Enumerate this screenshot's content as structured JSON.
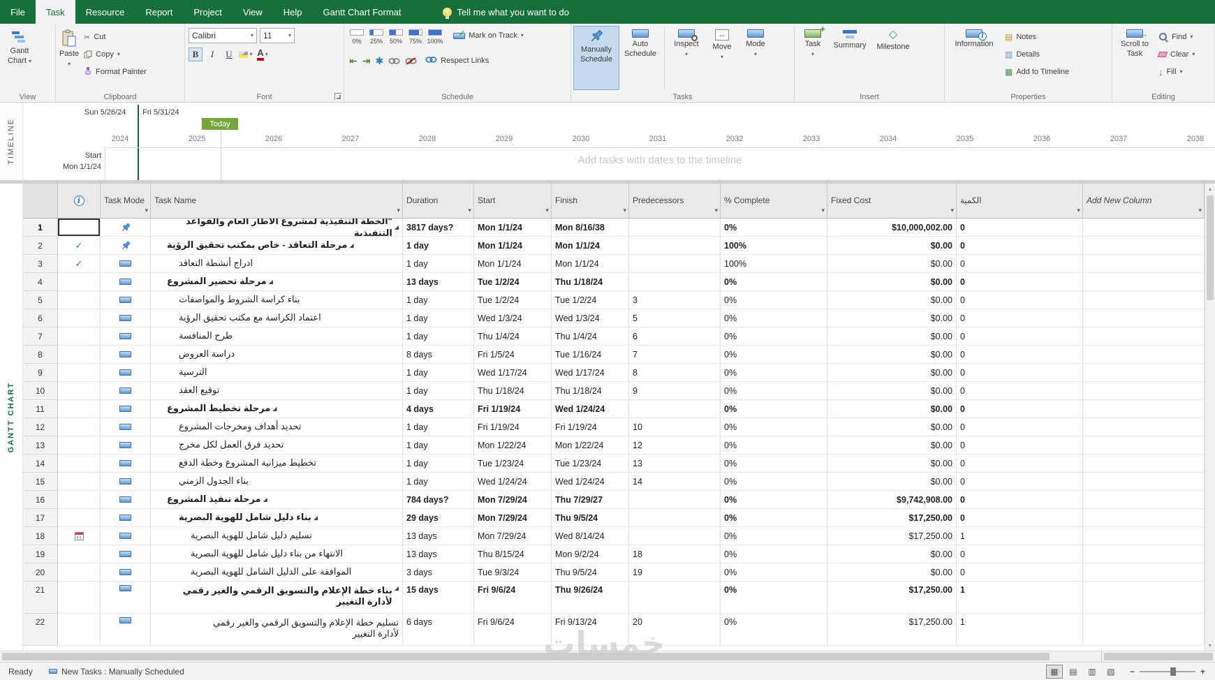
{
  "colors": {
    "brand_green": "#16703C",
    "accent_blue": "#2E75B6",
    "today_green": "#74A63D",
    "selection_blue": "#C5DAEE"
  },
  "menu": {
    "tabs": [
      {
        "label": "File"
      },
      {
        "label": "Task",
        "active": true
      },
      {
        "label": "Resource"
      },
      {
        "label": "Report"
      },
      {
        "label": "Project"
      },
      {
        "label": "View"
      },
      {
        "label": "Help"
      },
      {
        "label": "Gantt Chart Format"
      }
    ],
    "tell_me": "Tell me what you want to do"
  },
  "ribbon": {
    "view": {
      "group_label": "View",
      "gantt_chart": "Gantt Chart"
    },
    "clipboard": {
      "group_label": "Clipboard",
      "paste": "Paste",
      "cut": "Cut",
      "copy": "Copy",
      "format_painter": "Format Painter"
    },
    "font": {
      "group_label": "Font",
      "font_name": "Calibri",
      "font_size": "11",
      "bold": "B",
      "italic": "I",
      "underline": "U",
      "color_letter": "A"
    },
    "schedule": {
      "group_label": "Schedule",
      "percents": [
        "0%",
        "25%",
        "50%",
        "75%",
        "100%"
      ],
      "mark_on_track": "Mark on Track",
      "respect_links": "Respect Links"
    },
    "tasks": {
      "group_label": "Tasks",
      "manually_schedule": "Manually Schedule",
      "auto_schedule": "Auto Schedule",
      "inspect": "Inspect",
      "move": "Move",
      "mode": "Mode"
    },
    "insert": {
      "group_label": "Insert",
      "task": "Task",
      "summary": "Summary",
      "milestone": "Milestone"
    },
    "properties": {
      "group_label": "Properties",
      "information": "Information",
      "notes": "Notes",
      "details": "Details",
      "add_to_timeline": "Add to Timeline"
    },
    "editing": {
      "group_label": "Editing",
      "scroll_to_task": "Scroll to Task",
      "find": "Find",
      "clear": "Clear",
      "fill": "Fill"
    }
  },
  "timeline": {
    "pane_label": "TIMELINE",
    "range_start": "Sun 5/26/24",
    "range_end": "Fri 5/31/24",
    "today": "Today",
    "years": [
      "2024",
      "2025",
      "2026",
      "2027",
      "2028",
      "2029",
      "2030",
      "2031",
      "2032",
      "2033",
      "2034",
      "2035",
      "2036",
      "2037",
      "2038"
    ],
    "start_label": "Start",
    "start_date": "Mon 1/1/24",
    "placeholder": "Add tasks with dates to the timeline"
  },
  "gantt": {
    "pane_label": "GANTT CHART"
  },
  "table": {
    "columns": [
      {
        "id": "num",
        "label": "",
        "filter": false
      },
      {
        "id": "info",
        "label": "i",
        "filter": false
      },
      {
        "id": "mode",
        "label": "Task Mode",
        "filter": true
      },
      {
        "id": "name",
        "label": "Task Name",
        "filter": true
      },
      {
        "id": "dur",
        "label": "Duration",
        "filter": true
      },
      {
        "id": "start",
        "label": "Start",
        "filter": true
      },
      {
        "id": "fin",
        "label": "Finish",
        "filter": true
      },
      {
        "id": "pred",
        "label": "Predecessors",
        "filter": true
      },
      {
        "id": "pct",
        "label": "% Complete",
        "filter": true
      },
      {
        "id": "cost",
        "label": "Fixed Cost",
        "filter": true
      },
      {
        "id": "qty",
        "label": "الكمية",
        "filter": true
      },
      {
        "id": "add",
        "label": "Add New Column",
        "filter": true,
        "italic": true
      }
    ],
    "rows": [
      {
        "n": 1,
        "info": "",
        "cursor": true,
        "mode": "pin",
        "lvl": 0,
        "sum": true,
        "bold": true,
        "name": "\"الخطة التنفيذية لمشروع الاطار العام والقواعد التنفيذية",
        "dur": "3817 days?",
        "start": "Mon 1/1/24",
        "fin": "Mon 8/16/38",
        "pred": "",
        "pct": "0%",
        "cost": "$10,000,002.00",
        "qty": "0"
      },
      {
        "n": 2,
        "info": "check",
        "mode": "pin",
        "lvl": 1,
        "sum": true,
        "bold": true,
        "name": "مرحلة التعاقد - خاص بمكتب تحقيق الرؤية",
        "dur": "1 day",
        "start": "Mon 1/1/24",
        "fin": "Mon 1/1/24",
        "pred": "",
        "pct": "100%",
        "cost": "$0.00",
        "qty": "0"
      },
      {
        "n": 3,
        "info": "check",
        "mode": "auto",
        "lvl": 2,
        "name": "ادراج أنشطة التعاقد",
        "dur": "1 day",
        "start": "Mon 1/1/24",
        "fin": "Mon 1/1/24",
        "pred": "",
        "pct": "100%",
        "cost": "$0.00",
        "qty": "0"
      },
      {
        "n": 4,
        "info": "",
        "mode": "auto",
        "lvl": 1,
        "sum": true,
        "bold": true,
        "name": "مرحلة تحضير المشروع",
        "dur": "13 days",
        "start": "Tue 1/2/24",
        "fin": "Thu 1/18/24",
        "pred": "",
        "pct": "0%",
        "cost": "$0.00",
        "qty": "0"
      },
      {
        "n": 5,
        "info": "",
        "mode": "auto",
        "lvl": 2,
        "name": "بناء كراسة الشروط والمواصفات",
        "dur": "1 day",
        "start": "Tue 1/2/24",
        "fin": "Tue 1/2/24",
        "pred": "3",
        "pct": "0%",
        "cost": "$0.00",
        "qty": "0"
      },
      {
        "n": 6,
        "info": "",
        "mode": "auto",
        "lvl": 2,
        "name": "اعتماد الكراسة مع مكتب تحقيق الرؤية",
        "dur": "1 day",
        "start": "Wed 1/3/24",
        "fin": "Wed 1/3/24",
        "pred": "5",
        "pct": "0%",
        "cost": "$0.00",
        "qty": "0"
      },
      {
        "n": 7,
        "info": "",
        "mode": "auto",
        "lvl": 2,
        "name": "طرح المنافسة",
        "dur": "1 day",
        "start": "Thu 1/4/24",
        "fin": "Thu 1/4/24",
        "pred": "6",
        "pct": "0%",
        "cost": "$0.00",
        "qty": "0"
      },
      {
        "n": 8,
        "info": "",
        "mode": "auto",
        "lvl": 2,
        "name": "دراسة العروض",
        "dur": "8 days",
        "start": "Fri 1/5/24",
        "fin": "Tue 1/16/24",
        "pred": "7",
        "pct": "0%",
        "cost": "$0.00",
        "qty": "0"
      },
      {
        "n": 9,
        "info": "",
        "mode": "auto",
        "lvl": 2,
        "name": "الترسية",
        "dur": "1 day",
        "start": "Wed 1/17/24",
        "fin": "Wed 1/17/24",
        "pred": "8",
        "pct": "0%",
        "cost": "$0.00",
        "qty": "0"
      },
      {
        "n": 10,
        "info": "",
        "mode": "auto",
        "lvl": 2,
        "name": "توقيع العقد",
        "dur": "1 day",
        "start": "Thu 1/18/24",
        "fin": "Thu 1/18/24",
        "pred": "9",
        "pct": "0%",
        "cost": "$0.00",
        "qty": "0"
      },
      {
        "n": 11,
        "info": "",
        "mode": "auto",
        "lvl": 1,
        "sum": true,
        "bold": true,
        "name": "مرحلة تخطيط المشروع",
        "dur": "4 days",
        "start": "Fri 1/19/24",
        "fin": "Wed 1/24/24",
        "pred": "",
        "pct": "0%",
        "cost": "$0.00",
        "qty": "0"
      },
      {
        "n": 12,
        "info": "",
        "mode": "auto",
        "lvl": 2,
        "name": "تحديد أهداف ومخرجات المشروع",
        "dur": "1 day",
        "start": "Fri 1/19/24",
        "fin": "Fri 1/19/24",
        "pred": "10",
        "pct": "0%",
        "cost": "$0.00",
        "qty": "0"
      },
      {
        "n": 13,
        "info": "",
        "mode": "auto",
        "lvl": 2,
        "name": "تحديد فرق العمل لكل مخرج",
        "dur": "1 day",
        "start": "Mon 1/22/24",
        "fin": "Mon 1/22/24",
        "pred": "12",
        "pct": "0%",
        "cost": "$0.00",
        "qty": "0"
      },
      {
        "n": 14,
        "info": "",
        "mode": "auto",
        "lvl": 2,
        "name": "تخطيط ميزانية المشروع وخطة الدفع",
        "dur": "1 day",
        "start": "Tue 1/23/24",
        "fin": "Tue 1/23/24",
        "pred": "13",
        "pct": "0%",
        "cost": "$0.00",
        "qty": "0"
      },
      {
        "n": 15,
        "info": "",
        "mode": "auto",
        "lvl": 2,
        "name": "بناء الجدول الزمني",
        "dur": "1 day",
        "start": "Wed 1/24/24",
        "fin": "Wed 1/24/24",
        "pred": "14",
        "pct": "0%",
        "cost": "$0.00",
        "qty": "0"
      },
      {
        "n": 16,
        "info": "",
        "mode": "auto",
        "lvl": 1,
        "sum": true,
        "bold": true,
        "name": "مرحلة تنفيذ المشروع",
        "dur": "784 days?",
        "start": "Mon 7/29/24",
        "fin": "Thu 7/29/27",
        "pred": "",
        "pct": "0%",
        "cost": "$9,742,908.00",
        "qty": "0"
      },
      {
        "n": 17,
        "info": "",
        "mode": "auto",
        "lvl": 2,
        "sum": true,
        "bold": true,
        "name": "بناء دليل شامل للهوية البصرية",
        "dur": "29 days",
        "start": "Mon 7/29/24",
        "fin": "Thu 9/5/24",
        "pred": "",
        "pct": "0%",
        "cost": "$17,250.00",
        "qty": "0"
      },
      {
        "n": 18,
        "info": "cal",
        "mode": "auto",
        "lvl": 3,
        "name": "تسليم دليل شامل للهوية البصرية",
        "dur": "13 days",
        "start": "Mon 7/29/24",
        "fin": "Wed 8/14/24",
        "pred": "",
        "pct": "0%",
        "cost": "$17,250.00",
        "qty": "1"
      },
      {
        "n": 19,
        "info": "",
        "mode": "auto",
        "lvl": 3,
        "name": "الانتهاء من بناء دليل شامل للهوية البصرية",
        "dur": "13 days",
        "start": "Thu 8/15/24",
        "fin": "Mon 9/2/24",
        "pred": "18",
        "pct": "0%",
        "cost": "$0.00",
        "qty": "0"
      },
      {
        "n": 20,
        "info": "",
        "mode": "auto",
        "lvl": 3,
        "name": "الموافقة على الدليل الشامل للهوية البصرية",
        "dur": "3 days",
        "start": "Tue 9/3/24",
        "fin": "Thu 9/5/24",
        "pred": "19",
        "pct": "0%",
        "cost": "$0.00",
        "qty": "0"
      },
      {
        "n": 21,
        "info": "",
        "mode": "auto",
        "lvl": 2,
        "sum": true,
        "bold": true,
        "tall": true,
        "name": "بناء خطة الإعلام والتسويق الرقمي والغير رقمي لأدارة التغيير",
        "dur": "15 days",
        "start": "Fri 9/6/24",
        "fin": "Thu 9/26/24",
        "pred": "",
        "pct": "0%",
        "cost": "$17,250.00",
        "qty": "1"
      },
      {
        "n": 22,
        "info": "",
        "mode": "auto",
        "lvl": 3,
        "tall": true,
        "name": "تسليم خطة الإعلام والتسويق الرقمي والغير رقمي لأدارة التغيير",
        "dur": "6 days",
        "start": "Fri 9/6/24",
        "fin": "Fri 9/13/24",
        "pred": "20",
        "pct": "0%",
        "cost": "$17,250.00",
        "qty": "1"
      }
    ]
  },
  "status": {
    "ready": "Ready",
    "new_tasks_label": "New Tasks : Manually Scheduled"
  },
  "watermark": "خمسات",
  "icons": {
    "dropdown": "▾",
    "filter_arrow": "▾",
    "scissors": "✂",
    "outdent": "⇤",
    "indent": "⇥",
    "split": "✱",
    "check": "✓",
    "summary_marker": "◢",
    "milestone": "◇",
    "notes": "▤",
    "details": "▥",
    "add_timeline": "▦",
    "fill_arrow": "↓",
    "move_arrows": "↔",
    "right_arrow": "→",
    "info_letter": "i",
    "plus": "+",
    "up_arrow": "▴",
    "down_arrow": "▾",
    "view_gantt": "▦",
    "view_usage": "▤",
    "view_team": "▥",
    "view_sheet": "▧",
    "zoom_minus": "−",
    "zoom_plus": "+"
  }
}
